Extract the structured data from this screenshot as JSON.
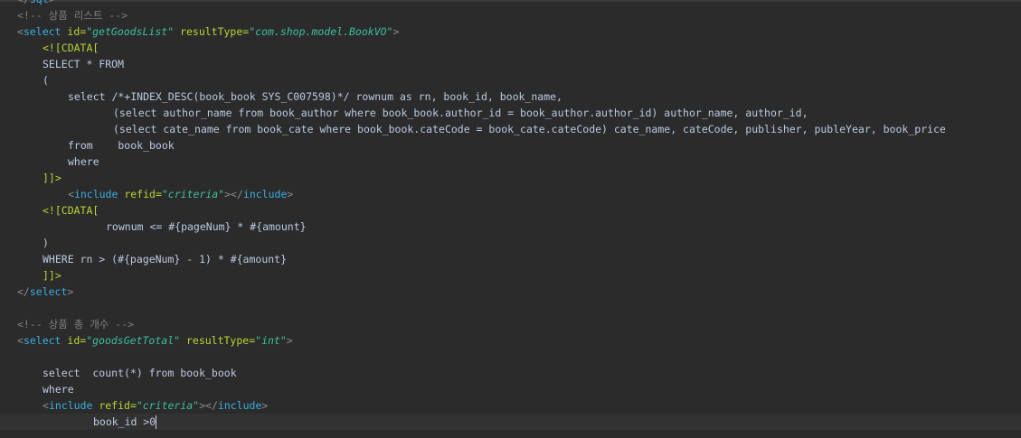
{
  "editor": {
    "lines": [
      {
        "indent": 19,
        "tokens": [
          {
            "t": "</",
            "c": "br"
          },
          {
            "t": "sql",
            "c": "tag"
          },
          {
            "t": ">",
            "c": "br"
          }
        ]
      },
      {
        "indent": 19,
        "tokens": [
          {
            "t": "<!-- 상품 리스트 -->",
            "c": "comment"
          }
        ]
      },
      {
        "indent": 19,
        "tokens": [
          {
            "t": "<",
            "c": "br"
          },
          {
            "t": "select ",
            "c": "tag"
          },
          {
            "t": "id=",
            "c": "attr"
          },
          {
            "t": "\"getGoodsList\"",
            "c": "str"
          },
          {
            "t": " resultType=",
            "c": "attr"
          },
          {
            "t": "\"com.shop.model.BookVO\"",
            "c": "str"
          },
          {
            "t": ">",
            "c": "br"
          }
        ]
      },
      {
        "indent": 47,
        "tokens": [
          {
            "t": "<![CDATA[",
            "c": "cdata"
          }
        ]
      },
      {
        "indent": 47,
        "tokens": [
          {
            "t": "SELECT * FROM",
            "c": "text"
          }
        ]
      },
      {
        "indent": 47,
        "tokens": [
          {
            "t": "(",
            "c": "text"
          }
        ]
      },
      {
        "indent": 75,
        "tokens": [
          {
            "t": "select /*+INDEX_DESC(book_book SYS_C007598)*/ rownum as rn, book_id, book_name,",
            "c": "text"
          }
        ]
      },
      {
        "indent": 125,
        "tokens": [
          {
            "t": "(select author_name from book_author where book_book.author_id = book_author.author_id) author_name, author_id,",
            "c": "text"
          }
        ]
      },
      {
        "indent": 125,
        "tokens": [
          {
            "t": "(select cate_name from book_cate where book_book.cateCode = book_cate.cateCode) cate_name, cateCode, publisher, publeYear, book_price",
            "c": "text"
          }
        ]
      },
      {
        "indent": 75,
        "tokens": [
          {
            "t": "from    book_book",
            "c": "text"
          }
        ]
      },
      {
        "indent": 75,
        "tokens": [
          {
            "t": "where",
            "c": "text"
          }
        ]
      },
      {
        "indent": 47,
        "tokens": [
          {
            "t": "]]>",
            "c": "cdata"
          }
        ]
      },
      {
        "indent": 75,
        "tokens": [
          {
            "t": "<",
            "c": "br"
          },
          {
            "t": "include ",
            "c": "tag"
          },
          {
            "t": "refid=",
            "c": "attr"
          },
          {
            "t": "\"criteria\"",
            "c": "str"
          },
          {
            "t": "></",
            "c": "br"
          },
          {
            "t": "include",
            "c": "tag"
          },
          {
            "t": ">",
            "c": "br"
          }
        ]
      },
      {
        "indent": 47,
        "tokens": [
          {
            "t": "<![CDATA[",
            "c": "cdata"
          }
        ]
      },
      {
        "indent": 117,
        "tokens": [
          {
            "t": "rownum <= #{pageNum} * #{amount}",
            "c": "text"
          }
        ]
      },
      {
        "indent": 47,
        "tokens": [
          {
            "t": ")",
            "c": "text"
          }
        ]
      },
      {
        "indent": 47,
        "tokens": [
          {
            "t": "WHERE rn > (#{pageNum} - 1) * #{amount}",
            "c": "text"
          }
        ]
      },
      {
        "indent": 47,
        "tokens": [
          {
            "t": "]]>",
            "c": "cdata"
          }
        ]
      },
      {
        "indent": 19,
        "tokens": [
          {
            "t": "</",
            "c": "br"
          },
          {
            "t": "select",
            "c": "tag"
          },
          {
            "t": ">",
            "c": "br"
          }
        ]
      },
      {
        "indent": 19,
        "tokens": []
      },
      {
        "indent": 19,
        "tokens": [
          {
            "t": "<!-- 상품 총 개수 -->",
            "c": "comment"
          }
        ]
      },
      {
        "indent": 19,
        "tokens": [
          {
            "t": "<",
            "c": "br"
          },
          {
            "t": "select ",
            "c": "tag"
          },
          {
            "t": "id=",
            "c": "attr"
          },
          {
            "t": "\"goodsGetTotal\"",
            "c": "str"
          },
          {
            "t": " resultType=",
            "c": "attr"
          },
          {
            "t": "\"int\"",
            "c": "str"
          },
          {
            "t": ">",
            "c": "br"
          }
        ]
      },
      {
        "indent": 19,
        "tokens": []
      },
      {
        "indent": 47,
        "tokens": [
          {
            "t": "select  count(*) from book_book",
            "c": "text"
          }
        ]
      },
      {
        "indent": 47,
        "tokens": [
          {
            "t": "where",
            "c": "text"
          }
        ]
      },
      {
        "indent": 47,
        "tokens": [
          {
            "t": "<",
            "c": "br"
          },
          {
            "t": "include ",
            "c": "tag"
          },
          {
            "t": "refid=",
            "c": "attr"
          },
          {
            "t": "\"criteria\"",
            "c": "str"
          },
          {
            "t": "></",
            "c": "br"
          },
          {
            "t": "include",
            "c": "tag"
          },
          {
            "t": ">",
            "c": "br"
          }
        ]
      },
      {
        "indent": 103,
        "current": true,
        "tokens": [
          {
            "t": "book_id >0",
            "c": "text"
          }
        ]
      }
    ]
  }
}
